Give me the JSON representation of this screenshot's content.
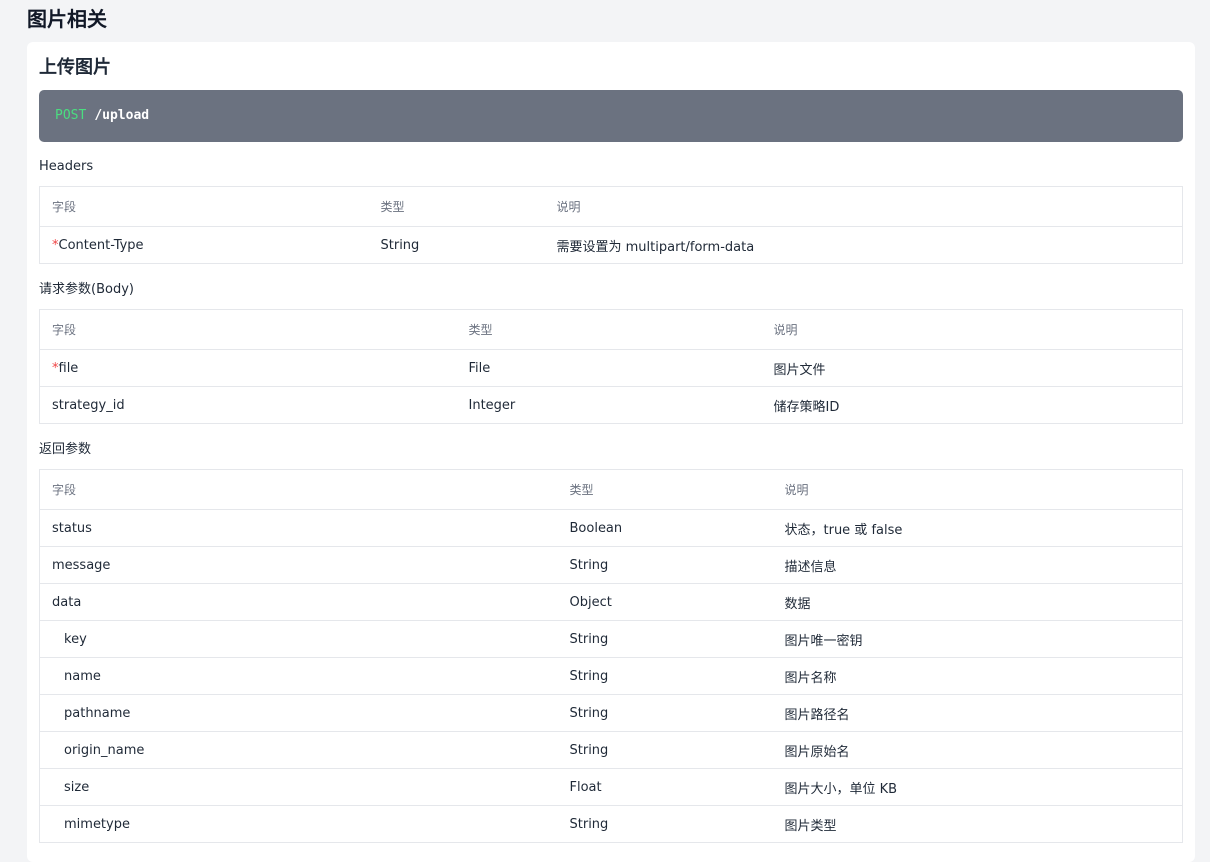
{
  "section_title": "图片相关",
  "card": {
    "title": "上传图片",
    "endpoint": {
      "method": "POST",
      "path": "/upload"
    },
    "headers": {
      "label": "Headers",
      "columns": [
        "字段",
        "类型",
        "说明"
      ],
      "rows": [
        {
          "field": "Content-Type",
          "required": true,
          "type": "String",
          "desc": "需要设置为 multipart/form-data"
        }
      ]
    },
    "body": {
      "label": "请求参数(Body)",
      "columns": [
        "字段",
        "类型",
        "说明"
      ],
      "rows": [
        {
          "field": "file",
          "required": true,
          "type": "File",
          "desc": "图片文件"
        },
        {
          "field": "strategy_id",
          "required": false,
          "type": "Integer",
          "desc": "储存策略ID"
        }
      ]
    },
    "response": {
      "label": "返回参数",
      "columns": [
        "字段",
        "类型",
        "说明"
      ],
      "rows": [
        {
          "field": "status",
          "indent": false,
          "type": "Boolean",
          "desc": "状态，true 或 false"
        },
        {
          "field": "message",
          "indent": false,
          "type": "String",
          "desc": "描述信息"
        },
        {
          "field": "data",
          "indent": false,
          "type": "Object",
          "desc": "数据"
        },
        {
          "field": "key",
          "indent": true,
          "type": "String",
          "desc": "图片唯一密钥"
        },
        {
          "field": "name",
          "indent": true,
          "type": "String",
          "desc": "图片名称"
        },
        {
          "field": "pathname",
          "indent": true,
          "type": "String",
          "desc": "图片路径名"
        },
        {
          "field": "origin_name",
          "indent": true,
          "type": "String",
          "desc": "图片原始名"
        },
        {
          "field": "size",
          "indent": true,
          "type": "Float",
          "desc": "图片大小，单位 KB"
        },
        {
          "field": "mimetype",
          "indent": true,
          "type": "String",
          "desc": "图片类型"
        }
      ]
    }
  },
  "colors": {
    "required_marker": "#ef4444",
    "method": "#4ade80",
    "endpoint_bg": "#6b7280"
  }
}
